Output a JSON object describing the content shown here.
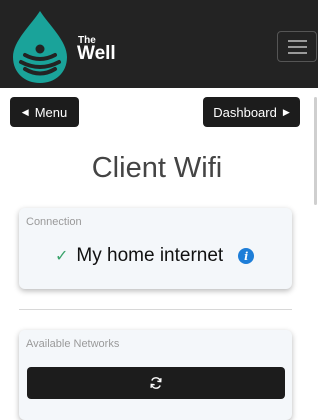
{
  "colors": {
    "header_bg": "#232323",
    "logo_teal": "#1aa39a",
    "accent_blue": "#1e7ed8",
    "success_green": "#3aa36b"
  },
  "header": {
    "logo": {
      "small": "The",
      "large": "Well"
    },
    "menu_icon": "hamburger-icon"
  },
  "nav": {
    "menu_label": "Menu",
    "menu_icon": "triangle-left-icon",
    "dashboard_label": "Dashboard",
    "dashboard_icon": "triangle-right-icon"
  },
  "page": {
    "title": "Client Wifi"
  },
  "connection": {
    "label": "Connection",
    "status_icon": "checkmark-icon",
    "network_name": "My home internet",
    "info_icon": "info-icon"
  },
  "available": {
    "label": "Available Networks",
    "refresh_icon": "refresh-icon"
  }
}
